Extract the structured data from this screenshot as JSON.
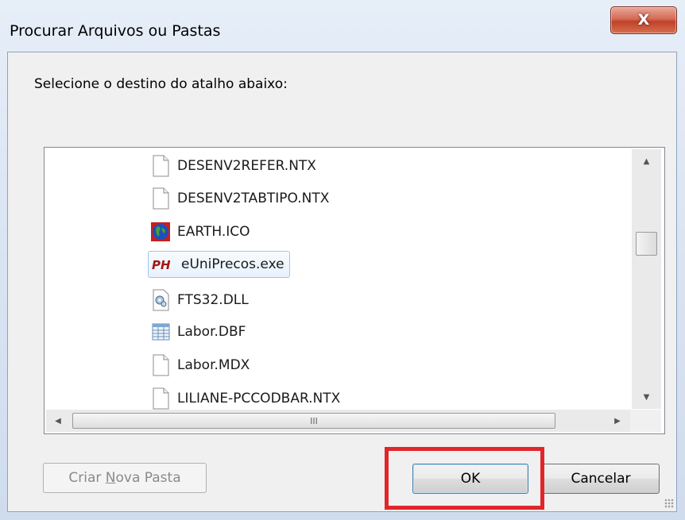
{
  "window": {
    "title": "Procurar Arquivos ou Pastas",
    "close_glyph": "X"
  },
  "instruction": "Selecione o destino do atalho abaixo:",
  "tree": {
    "items": [
      {
        "label": "DESENV2REFER.NTX",
        "icon": "blank-file-icon",
        "selected": false
      },
      {
        "label": "DESENV2TABTIPO.NTX",
        "icon": "blank-file-icon",
        "selected": false
      },
      {
        "label": "EARTH.ICO",
        "icon": "earth-icon",
        "selected": false
      },
      {
        "label": "eUniPrecos.exe",
        "icon": "ph-app-icon",
        "selected": true
      },
      {
        "label": "FTS32.DLL",
        "icon": "dll-gear-icon",
        "selected": false
      },
      {
        "label": "Labor.DBF",
        "icon": "table-file-icon",
        "selected": false
      },
      {
        "label": "Labor.MDX",
        "icon": "blank-file-icon",
        "selected": false
      },
      {
        "label": "LILIANE-PCCODBAR.NTX",
        "icon": "blank-file-icon",
        "selected": false
      }
    ],
    "app_icon_text": "PH",
    "hscroll_grip": "III"
  },
  "buttons": {
    "new_folder_pre": "Criar ",
    "new_folder_hotkey": "N",
    "new_folder_post": "ova Pasta",
    "ok": "OK",
    "cancel": "Cancelar"
  },
  "colors": {
    "highlight": "#e0262b",
    "selection_border": "#9ec6ea"
  }
}
